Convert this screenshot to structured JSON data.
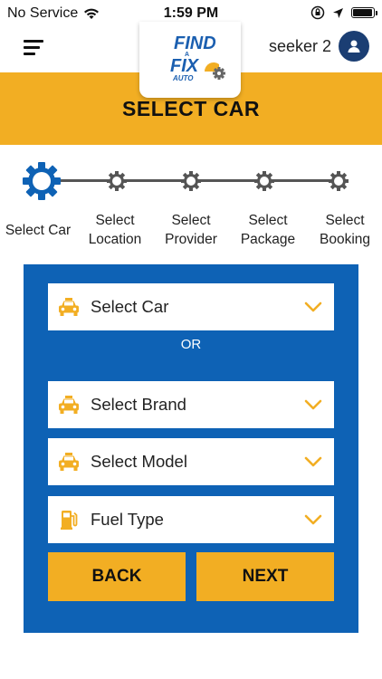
{
  "status_bar": {
    "carrier": "No Service",
    "time": "1:59 PM",
    "battery_level": 0.95
  },
  "header": {
    "logo": {
      "line1": "FIND",
      "line2": "A",
      "line3": "FIX",
      "line4": "AUTO"
    },
    "username": "seeker 2"
  },
  "page_title": "SELECT CAR",
  "stepper": {
    "current_step": 0,
    "steps": [
      {
        "label_line1": "Select Car",
        "label_line2": ""
      },
      {
        "label_line1": "Select",
        "label_line2": "Location"
      },
      {
        "label_line1": "Select",
        "label_line2": "Provider"
      },
      {
        "label_line1": "Select",
        "label_line2": "Package"
      },
      {
        "label_line1": "Select",
        "label_line2": "Booking"
      }
    ]
  },
  "form": {
    "select_car": {
      "label": "Select Car",
      "icon": "taxi-icon"
    },
    "or_text": "OR",
    "select_brand": {
      "label": "Select Brand",
      "icon": "taxi-icon"
    },
    "select_model": {
      "label": "Select Model",
      "icon": "taxi-icon"
    },
    "fuel_type": {
      "label": "Fuel Type",
      "icon": "fuel-pump-icon"
    },
    "back_label": "BACK",
    "next_label": "NEXT"
  },
  "colors": {
    "accent_yellow": "#F2AE23",
    "panel_blue": "#0E62B5",
    "stepper_blue": "#0E62B5",
    "logo_navy": "#1b3e73"
  }
}
